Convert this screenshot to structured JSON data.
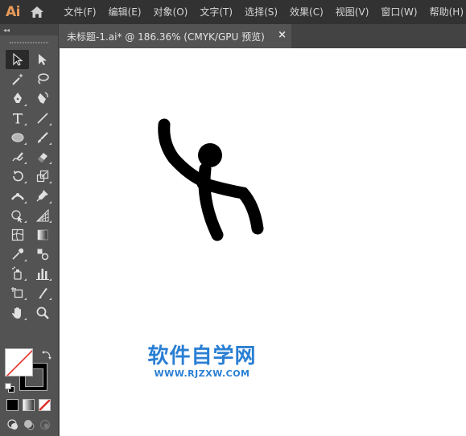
{
  "app": {
    "logo_text": "Ai"
  },
  "menu": {
    "items": [
      {
        "label": "文件(F)"
      },
      {
        "label": "编辑(E)"
      },
      {
        "label": "对象(O)"
      },
      {
        "label": "文字(T)"
      },
      {
        "label": "选择(S)"
      },
      {
        "label": "效果(C)"
      },
      {
        "label": "视图(V)"
      },
      {
        "label": "窗口(W)"
      },
      {
        "label": "帮助(H)"
      }
    ]
  },
  "toolbar": {
    "collapse_label": "◂◂",
    "tools": [
      "selection-tool",
      "direct-selection-tool",
      "magic-wand-tool",
      "lasso-tool",
      "pen-tool",
      "curvature-tool",
      "type-tool",
      "line-segment-tool",
      "ellipse-tool",
      "paintbrush-tool",
      "shaper-tool",
      "eraser-tool",
      "rotate-tool",
      "scale-tool",
      "width-tool",
      "puppet-warp-tool",
      "shape-builder-tool",
      "perspective-grid-tool",
      "mesh-tool",
      "gradient-tool",
      "eyedropper-tool",
      "blend-tool",
      "symbol-sprayer-tool",
      "column-graph-tool",
      "artboard-tool",
      "slice-tool",
      "hand-tool",
      "zoom-tool"
    ],
    "active_tool": "selection-tool",
    "fill": "none",
    "stroke": "#000000"
  },
  "document": {
    "tab_label": "未标题-1.ai* @ 186.36% (CMYK/GPU 预览)",
    "close_label": "×"
  },
  "colors": {
    "menubar_bg": "#323232",
    "panel_bg": "#535353",
    "accent_logo": "#e79a5b",
    "canvas_bg": "#ffffff",
    "artwork_stroke": "#000000",
    "watermark": "#2a7fd4"
  },
  "watermark": {
    "title": "软件自学网",
    "url": "WWW.RJZXW.COM"
  }
}
